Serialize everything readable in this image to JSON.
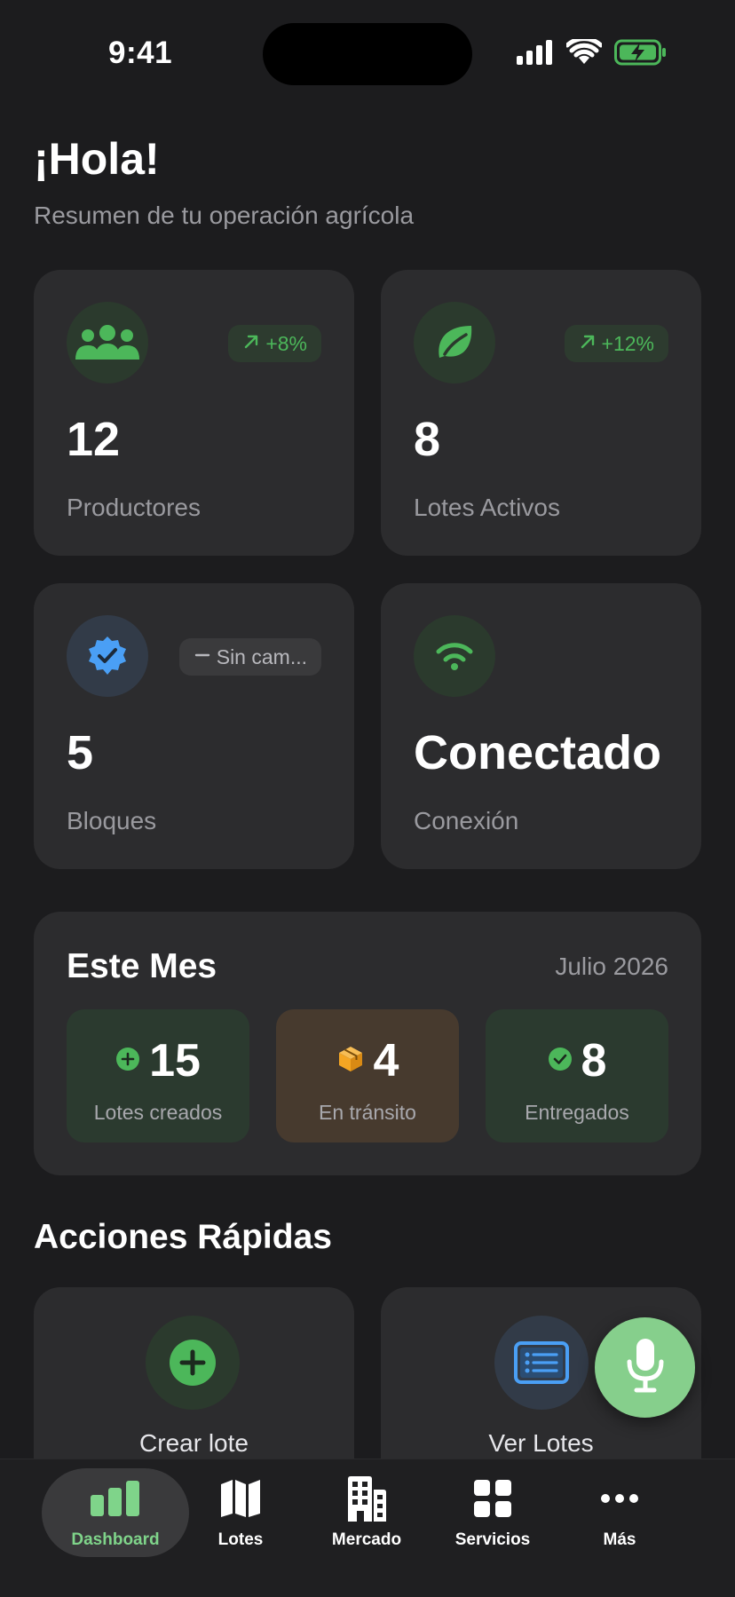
{
  "status_bar": {
    "time": "9:41"
  },
  "header": {
    "greeting": "¡Hola!",
    "subtitle": "Resumen de tu operación agrícola"
  },
  "stats": [
    {
      "icon": "users-icon",
      "trend": "+8%",
      "value": "12",
      "label": "Productores"
    },
    {
      "icon": "leaf-icon",
      "trend": "+12%",
      "value": "8",
      "label": "Lotes Activos"
    },
    {
      "icon": "verified-badge-icon",
      "trend": "Sin cam...",
      "value": "5",
      "label": "Bloques"
    },
    {
      "icon": "wifi-icon",
      "value": "Conectado",
      "label": "Conexión"
    }
  ],
  "month": {
    "title": "Este Mes",
    "date": "Julio 2026",
    "items": [
      {
        "icon": "plus-circle-icon",
        "value": "15",
        "label": "Lotes creados"
      },
      {
        "icon": "package-icon",
        "value": "4",
        "label": "En tránsito"
      },
      {
        "icon": "check-circle-icon",
        "value": "8",
        "label": "Entregados"
      }
    ]
  },
  "quick_actions": {
    "title": "Acciones Rápidas",
    "items": [
      {
        "icon": "plus-icon",
        "label": "Crear lote"
      },
      {
        "icon": "list-icon",
        "label": "Ver Lotes"
      }
    ]
  },
  "fab": {
    "icon": "microphone-icon"
  },
  "tabs": [
    {
      "icon": "chart-bars-icon",
      "label": "Dashboard",
      "active": true
    },
    {
      "icon": "map-icon",
      "label": "Lotes"
    },
    {
      "icon": "building-icon",
      "label": "Mercado"
    },
    {
      "icon": "grid-icon",
      "label": "Servicios"
    },
    {
      "icon": "more-icon",
      "label": "Más"
    }
  ],
  "colors": {
    "background": "#1c1c1e",
    "card": "#2c2c2e",
    "accent_green": "#4cb75a",
    "fab_green": "#86cf8c",
    "tab_active": "#7fd48a",
    "blue": "#4a9ff5",
    "orange": "#f5a623"
  }
}
